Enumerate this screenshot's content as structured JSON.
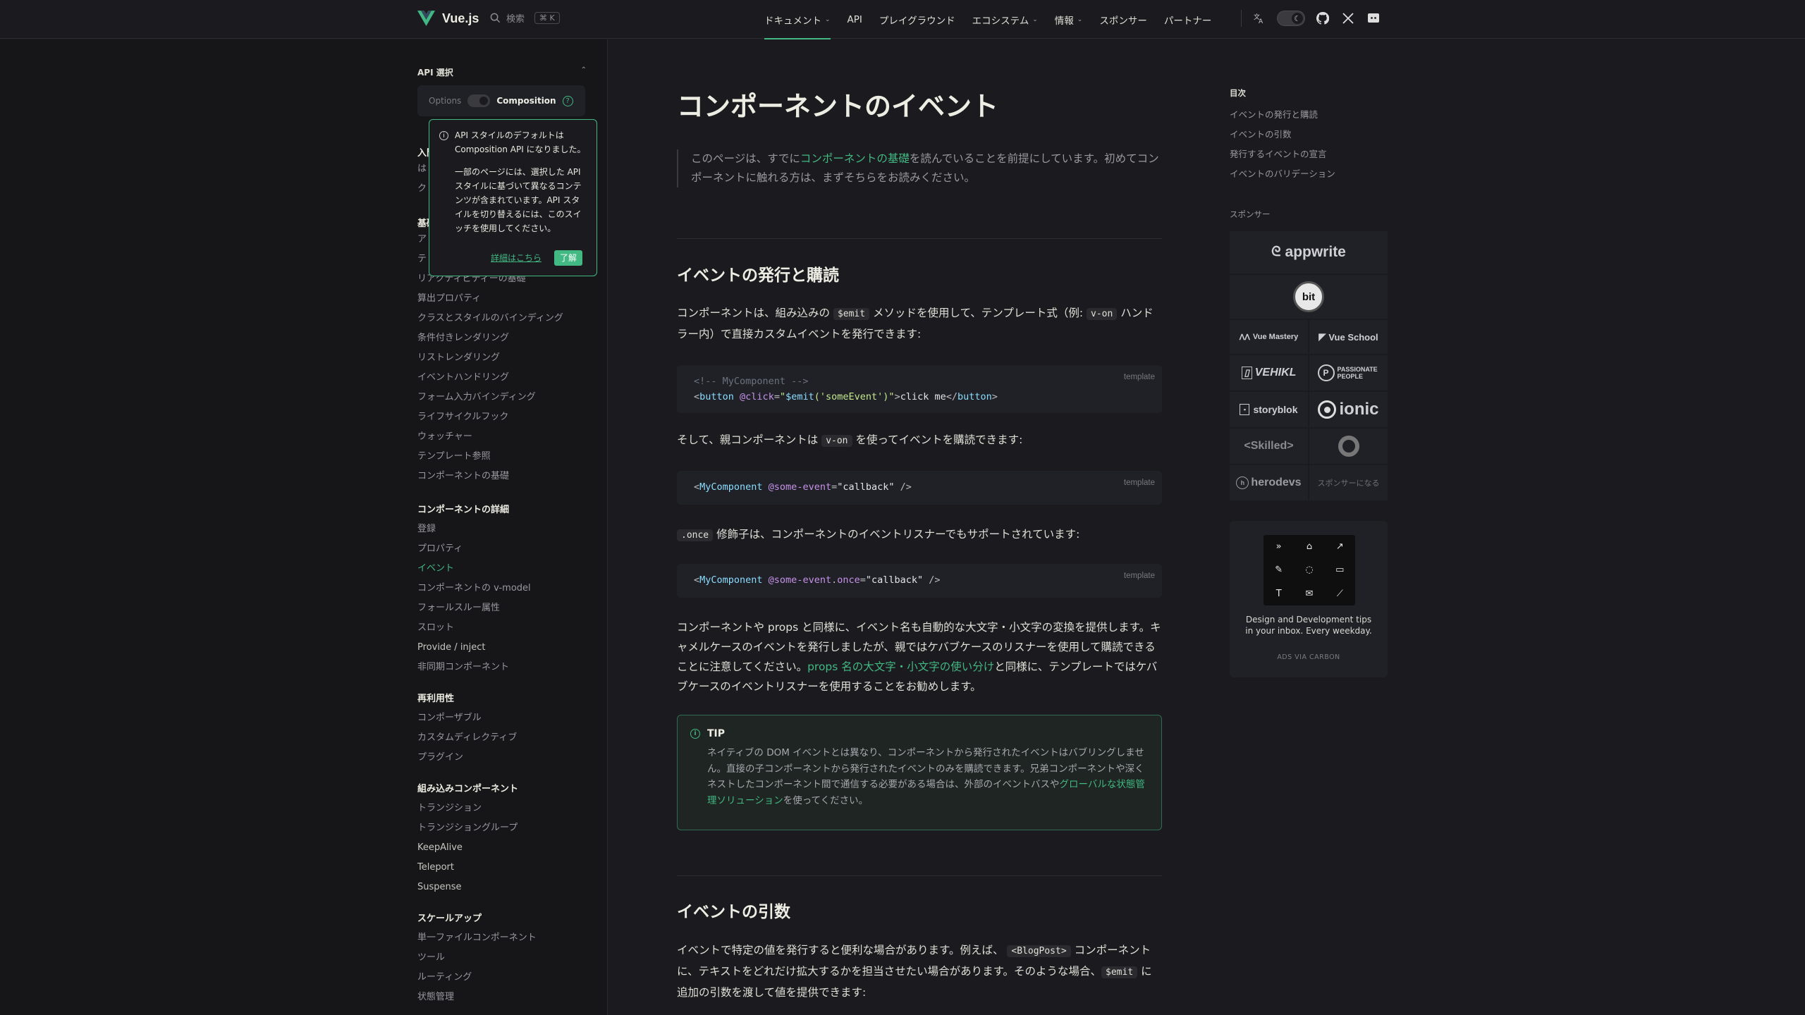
{
  "colors": {
    "accent": "#42b883",
    "bg": "#1b1b1f",
    "sidebar_bg": "#161618"
  },
  "nav": {
    "brand": "Vue.js",
    "search_label": "検索",
    "search_kbd": "⌘ K",
    "menu": [
      {
        "label": "ドキュメント",
        "dropdown": true,
        "active": true
      },
      {
        "label": "API",
        "dropdown": false
      },
      {
        "label": "プレイグラウンド",
        "dropdown": false
      },
      {
        "label": "エコシステム",
        "dropdown": true
      },
      {
        "label": "情報",
        "dropdown": true
      },
      {
        "label": "スポンサー",
        "dropdown": false
      },
      {
        "label": "パートナー",
        "dropdown": false
      }
    ],
    "icons": [
      "translate-icon",
      "theme-toggle",
      "github-icon",
      "x-icon",
      "discord-icon"
    ]
  },
  "sidebar": {
    "api_heading": "API 選択",
    "api_options": "Options",
    "api_composition": "Composition",
    "help_glyph": "?",
    "intro_partial": [
      "入門",
      "は",
      "ク"
    ],
    "basics_partial": [
      "基礎",
      "ア",
      "テ"
    ],
    "basics_items": [
      "リアクティビティーの基礎",
      "算出プロパティ",
      "クラスとスタイルのバインディング",
      "条件付きレンダリング",
      "リストレンダリング",
      "イベントハンドリング",
      "フォーム入力バインディング",
      "ライフサイクルフック",
      "ウォッチャー",
      "テンプレート参照",
      "コンポーネントの基礎"
    ],
    "groups": [
      {
        "title": "コンポーネントの詳細",
        "items": [
          "登録",
          "プロパティ",
          "イベント",
          "コンポーネントの v-model",
          "フォールスルー属性",
          "スロット",
          "Provide / inject",
          "非同期コンポーネント"
        ],
        "active_index": 2
      },
      {
        "title": "再利用性",
        "items": [
          "コンポーザブル",
          "カスタムディレクティブ",
          "プラグイン"
        ]
      },
      {
        "title": "組み込みコンポーネント",
        "items": [
          "トランジション",
          "トランジショングループ",
          "KeepAlive",
          "Teleport",
          "Suspense"
        ]
      },
      {
        "title": "スケールアップ",
        "items": [
          "単一ファイルコンポーネント",
          "ツール",
          "ルーティング",
          "状態管理"
        ]
      }
    ]
  },
  "popup": {
    "p1": "API スタイルのデフォルトは Composition API になりました。",
    "p2": "一部のページには、選択した API スタイルに基づいて異なるコンテンツが含まれています。API スタイルを切り替えるには、このスイッチを使用してください。",
    "more_label": "詳細はこちら",
    "ok_label": "了解"
  },
  "content": {
    "title": "コンポーネントのイベント",
    "lead_before": "このページは、すでに",
    "lead_link": "コンポーネントの基礎",
    "lead_after": "を読んでいることを前提にしています。初めてコンポーネントに触れる方は、まずそちらをお読みください。",
    "h2_emit": "イベントの発行と購読",
    "p_emit_1": "コンポーネントは、組み込みの",
    "p_emit_code": "$emit",
    "p_emit_2": "メソッドを使用して、テンプレート式（例:",
    "p_emit_code2": "v-on",
    "p_emit_3": "ハンドラー内）で直接カスタムイベントを発行できます:",
    "code1_lang": "template",
    "code1_line1": "<!-- MyComponent -->",
    "code1_line2": "<button @click=\"$emit('someEvent')\">click me</button>",
    "code1_parts": {
      "open": "<",
      "tag": "button",
      "attr": " @click",
      "eq": "=",
      "q": "\"",
      "fn": "$emit",
      "arg": "('someEvent')",
      "gt": ">",
      "text": "click me",
      "close": "</",
      "gt2": ">"
    },
    "p_listen_1": "そして、親コンポーネントは",
    "p_listen_code": "v-on",
    "p_listen_2": "を使ってイベントを購読できます:",
    "code2_lang": "template",
    "code2_parts": {
      "open": "<",
      "tag": "MyComponent",
      "attr": " @some-event",
      "eq": "=",
      "str": "\"callback\"",
      "end": " />"
    },
    "p_once_code": ".once",
    "p_once": "修飾子は、コンポーネントのイベントリスナーでもサポートされています:",
    "code3_lang": "template",
    "code3_parts": {
      "open": "<",
      "tag": "MyComponent",
      "attr": " @some-event",
      "dot": ".",
      "mod": "once",
      "eq": "=",
      "str": "\"callback\"",
      "end": " />"
    },
    "p_case_1": "コンポーネントや props と同様に、イベント名も自動的な大文字・小文字の変換を提供します。キャメルケースのイベントを発行しましたが、親ではケバブケースのリスナーを使用して購読できることに注意してください。",
    "p_case_link": "props 名の大文字・小文字の使い分け",
    "p_case_2": "と同様に、テンプレートではケバブケースのイベントリスナーを使用することをお勧めします。",
    "tip_title": "TIP",
    "tip_body": "ネイティブの DOM イベントとは異なり、コンポーネントから発行されたイベントはバブリングしません。直接の子コンポーネントから発行されたイベントのみを購読できます。兄弟コンポーネントや深くネストしたコンポーネント間で通信する必要がある場合は、外部のイベントバスや",
    "tip_link": "グローバルな状態管理ソリューション",
    "tip_after": "を使ってください。",
    "h2_args": "イベントの引数",
    "p_args_1": "イベントで特定の値を発行すると便利な場合があります。例えば、",
    "p_args_code": "<BlogPost>",
    "p_args_2": "コンポーネントに、テキストをどれだけ拡大するかを担当させたい場合があります。そのような場合、",
    "p_args_code2": "$emit",
    "p_args_3": "に追加の引数を渡して値を提供できます:"
  },
  "aside": {
    "toc_title": "目次",
    "toc": [
      "イベントの発行と購読",
      "イベントの引数",
      "発行するイベントの宣言",
      "イベントのバリデーション"
    ],
    "sponsors_title": "スポンサー",
    "sponsors": [
      "appwrite",
      "bit",
      "Vue Mastery",
      "Vue School",
      "VEHIKL",
      "PASSIONATE PEOPLE",
      "storyblok",
      "ionic",
      "<Skilled>",
      "",
      "herodevs",
      "スポンサーになる"
    ],
    "carbon_text": "Design and Development tips in your inbox. Every weekday.",
    "carbon_via": "ADS VIA CARBON"
  }
}
